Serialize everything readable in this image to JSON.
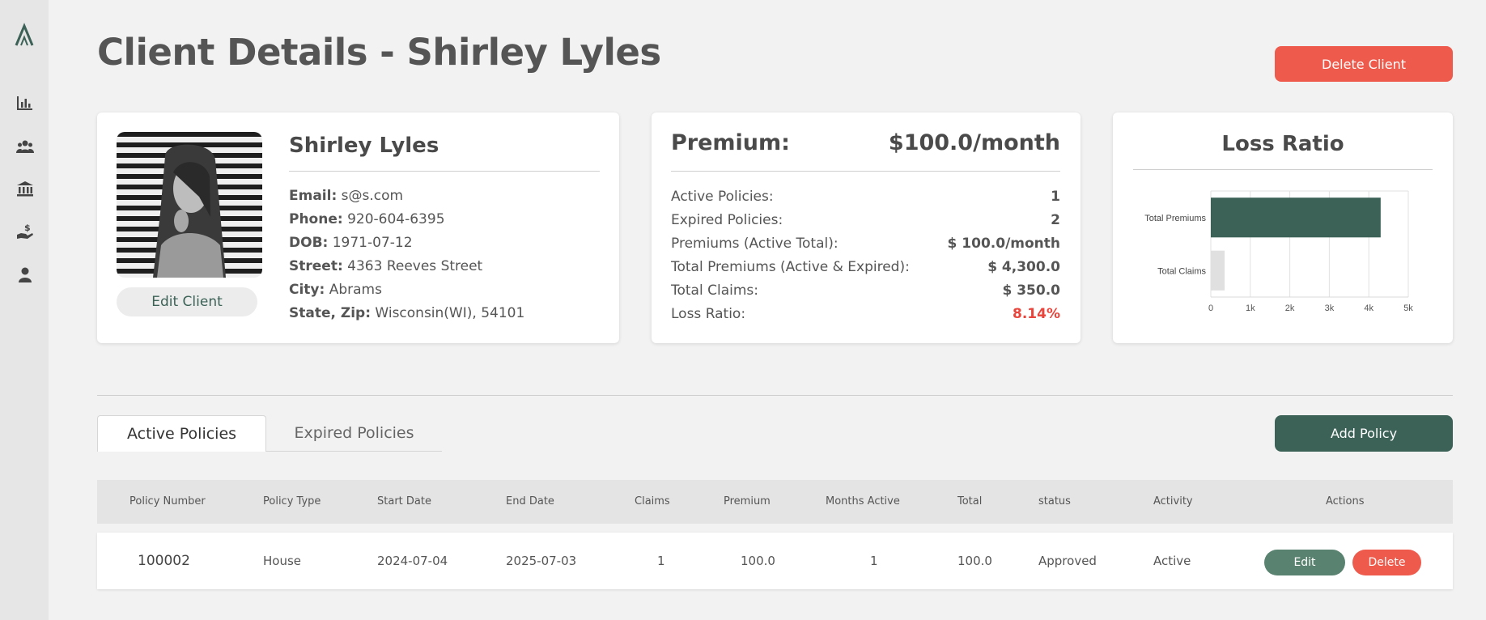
{
  "app": {
    "logo_icon": "logo-a-icon"
  },
  "sidebar": {
    "items": [
      {
        "icon": "bar-chart-icon",
        "name": "dashboard"
      },
      {
        "icon": "users-icon",
        "name": "clients"
      },
      {
        "icon": "bank-icon",
        "name": "institutions"
      },
      {
        "icon": "hand-dollar-icon",
        "name": "payments"
      },
      {
        "icon": "user-icon",
        "name": "profile"
      }
    ]
  },
  "header": {
    "title": "Client Details - Shirley Lyles",
    "delete_label": "Delete Client"
  },
  "profile": {
    "name": "Shirley Lyles",
    "edit_label": "Edit Client",
    "fields": [
      {
        "label": "Email:",
        "value": "s@s.com"
      },
      {
        "label": "Phone:",
        "value": "920-604-6395"
      },
      {
        "label": "DOB:",
        "value": "1971-07-12"
      },
      {
        "label": "Street:",
        "value": "4363 Reeves Street"
      },
      {
        "label": "City:",
        "value": "Abrams"
      },
      {
        "label": "State, Zip:",
        "value": "Wisconsin(WI), 54101"
      }
    ]
  },
  "premium": {
    "label": "Premium:",
    "value": "$100.0/month",
    "stats": [
      {
        "label": "Active Policies:",
        "value": "1"
      },
      {
        "label": "Expired Policies:",
        "value": "2"
      },
      {
        "label": "Premiums (Active Total):",
        "value": "$ 100.0/month"
      },
      {
        "label": "Total Premiums (Active & Expired):",
        "value": "$ 4,300.0"
      },
      {
        "label": "Total Claims:",
        "value": "$ 350.0"
      },
      {
        "label": "Loss Ratio:",
        "value": "8.14%"
      }
    ],
    "loss_ratio_color": "#e8453c"
  },
  "chart_data": {
    "type": "bar",
    "orientation": "horizontal",
    "title": "Loss Ratio",
    "categories": [
      "Total Premiums",
      "Total Claims"
    ],
    "values": [
      4300,
      350
    ],
    "colors": [
      "#3c6257",
      "#e0e0e0"
    ],
    "xlim": [
      0,
      5000
    ],
    "xticks": [
      "0",
      "1k",
      "2k",
      "3k",
      "4k",
      "5k"
    ],
    "grid": true
  },
  "tabs": [
    {
      "label": "Active Policies",
      "active": true
    },
    {
      "label": "Expired Policies",
      "active": false
    }
  ],
  "add_policy_label": "Add Policy",
  "table": {
    "headers": [
      "Policy Number",
      "Policy Type",
      "Start Date",
      "End Date",
      "Claims",
      "Premium",
      "Months Active",
      "Total",
      "status",
      "Activity",
      "Actions"
    ],
    "rows": [
      {
        "policy_number": "100002",
        "type": "House",
        "start": "2024-07-04",
        "end": "2025-07-03",
        "claims": "1",
        "premium": "100.0",
        "months": "1",
        "total": "100.0",
        "status": "Approved",
        "activity": "Active"
      }
    ],
    "edit_label": "Edit",
    "delete_label": "Delete"
  },
  "colors": {
    "accent": "#3c6257",
    "danger": "#ee5a4b"
  }
}
